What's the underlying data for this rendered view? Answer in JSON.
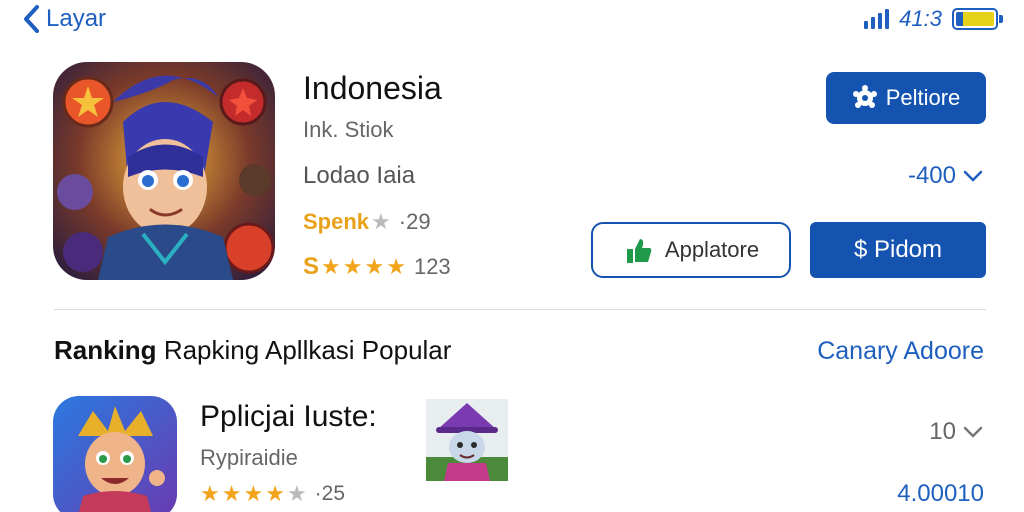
{
  "status_bar": {
    "back_label": "Layar",
    "time": "41:3",
    "battery_color": "#e7d21b",
    "accent": "#1f5fbf"
  },
  "app": {
    "title": "Indonesia",
    "developer": "Ink. Stiok",
    "category": "Lodao Iaia",
    "rating_label": "Spenk",
    "rating_count_1": "29",
    "rating_count_2": "123",
    "icon": "game-hero-icon"
  },
  "buttons": {
    "top_primary": "Peltiore",
    "outline": "Applatore",
    "bottom_primary": "$ Pidom"
  },
  "price": {
    "value": "-400"
  },
  "section": {
    "title_bold": "Ranking",
    "title_rest": "Rapking Apllkasi Popular",
    "link": "Canary Adoore"
  },
  "list_item": {
    "title": "Pplicjai Iuste:",
    "subtitle": "Rypiraidie",
    "rating_count": "25",
    "dropdown_value": "10",
    "value": "4.00010",
    "icon": "jester-character-icon",
    "thumb": "wizard-character-thumb"
  },
  "colors": {
    "primary": "#1454b0",
    "star": "#f2a51c"
  }
}
